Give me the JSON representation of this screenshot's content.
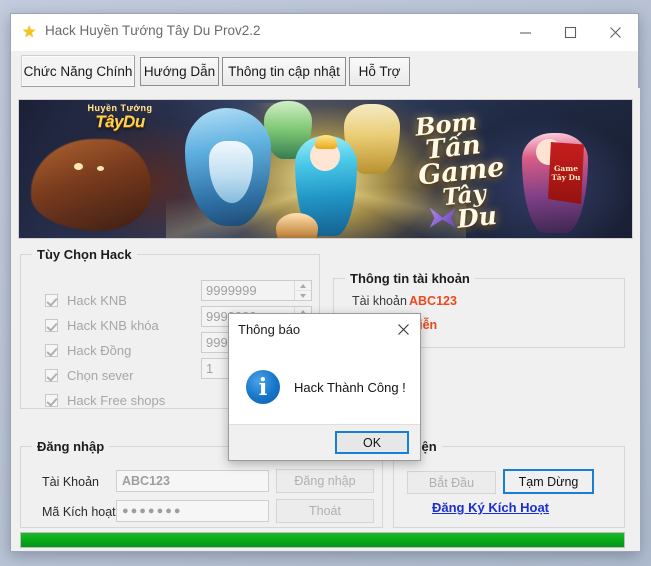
{
  "window": {
    "title": "Hack Huyền Tướng Tây Du  Prov2.2",
    "star_icon": "★",
    "minimize_label": "Minimize",
    "maximize_label": "Maximize",
    "close_label": "Close"
  },
  "tabs": [
    {
      "label": "Chức Năng Chính",
      "selected": true
    },
    {
      "label": "Hướng Dẫn",
      "selected": false
    },
    {
      "label": "Thông tin cập nhật",
      "selected": false
    },
    {
      "label": "Hỗ Trợ",
      "selected": false
    }
  ],
  "banner": {
    "logo_top": "Huyền Tướng",
    "logo_main": "TâyDu",
    "slogan": [
      "Bom",
      "Tấn",
      "Game",
      "Tây",
      "Du"
    ],
    "ribbon": "Game Tây Du"
  },
  "hack_options": {
    "legend": "Tùy Chọn Hack",
    "items": [
      {
        "label": "Hack KNB",
        "checked": true,
        "value": "9999999",
        "has_spinner": true
      },
      {
        "label": "Hack KNB khóa",
        "checked": true,
        "value": "9999999",
        "has_spinner": true
      },
      {
        "label": "Hack Đồng",
        "checked": true,
        "value": "9999999",
        "has_spinner": true
      },
      {
        "label": "Chọn sever",
        "checked": true,
        "value": "1",
        "has_spinner": true
      },
      {
        "label": "Hack Free shops",
        "checked": true,
        "value": "",
        "has_spinner": false
      }
    ]
  },
  "account_info": {
    "legend": "Thông tin tài khoản",
    "rows": [
      {
        "label": "Tài khoản",
        "value": "ABC123"
      },
      {
        "label": "",
        "value": "Viễn"
      }
    ]
  },
  "login": {
    "legend": "Đăng nhập",
    "account_label": "Tài Khoản",
    "account_value": "ABC123",
    "key_label": "Mã Kích hoạt",
    "key_value": "●●●●●●●",
    "login_button": "Đăng nhập",
    "exit_button": "Thoát"
  },
  "execute": {
    "legend": "hiện",
    "start_button": "Bắt Đầu",
    "pause_button": "Tạm Dừng",
    "register_link": "Đăng Ký Kích Hoạt"
  },
  "progress": {
    "percent": "100"
  },
  "dialog": {
    "title": "Thông báo",
    "message": "Hack Thành Công !",
    "ok_button": "OK",
    "icon": "i",
    "close_icon": "×"
  },
  "colors": {
    "accent_orange": "#ec4a1c",
    "link_blue": "#1a2fd0",
    "focus_blue": "#1a7fd4",
    "progress_green": "#06a81b"
  }
}
